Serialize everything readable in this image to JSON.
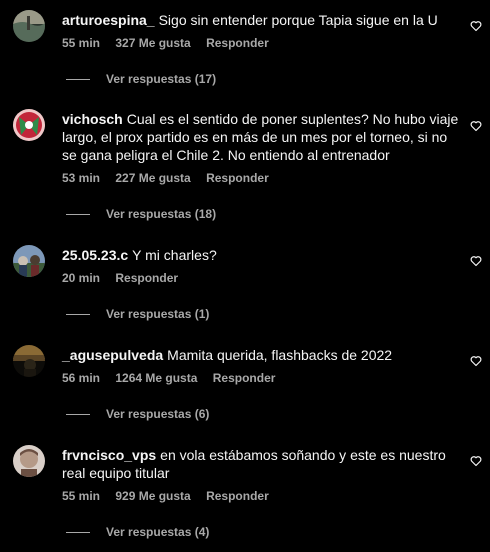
{
  "comments": [
    {
      "username": "arturoespina_",
      "text": "Sigo sin entender porque Tapia sigue en la U",
      "time": "55 min",
      "likes": "327 Me gusta",
      "reply_label": "Responder",
      "view_replies": "Ver respuestas (17)",
      "avatar_colors": [
        "#9a9a88",
        "#566b5a",
        "#2b352e"
      ],
      "like_icon": "heart-icon"
    },
    {
      "username": "vichosch",
      "text": "Cual es el sentido de poner suplentes? No hubo viaje largo, el prox partido es en más de un mes por el torneo, si no se gana peligra el Chile 2. No entiendo al entrenador",
      "time": "53 min",
      "likes": "227 Me gusta",
      "reply_label": "Responder",
      "view_replies": "Ver respuestas (18)",
      "avatar_colors": [
        "#c2263a",
        "#2f8c4a",
        "#f0c8c8"
      ],
      "like_icon": "heart-icon"
    },
    {
      "username": "25.05.23.c",
      "text": "Y mi charles?",
      "time": "20 min",
      "likes": "",
      "reply_label": "Responder",
      "view_replies": "Ver respuestas (1)",
      "avatar_colors": [
        "#7d98b8",
        "#3c5a3a",
        "#c9c0b4"
      ],
      "like_icon": "heart-icon"
    },
    {
      "username": "_agusepulveda",
      "text": "Mamita querida, flashbacks de 2022",
      "time": "56 min",
      "likes": "1264 Me gusta",
      "reply_label": "Responder",
      "view_replies": "Ver respuestas (6)",
      "avatar_colors": [
        "#8a6a35",
        "#2a2418",
        "#0d0c09"
      ],
      "like_icon": "heart-icon"
    },
    {
      "username": "frvncisco_vps",
      "text": "en vola estábamos soñando y este es nuestro real equipo titular",
      "time": "55 min",
      "likes": "929 Me gusta",
      "reply_label": "Responder",
      "view_replies": "Ver respuestas (4)",
      "avatar_colors": [
        "#b59a88",
        "#6b4f42",
        "#d9cfc8"
      ],
      "like_icon": "heart-icon"
    }
  ]
}
